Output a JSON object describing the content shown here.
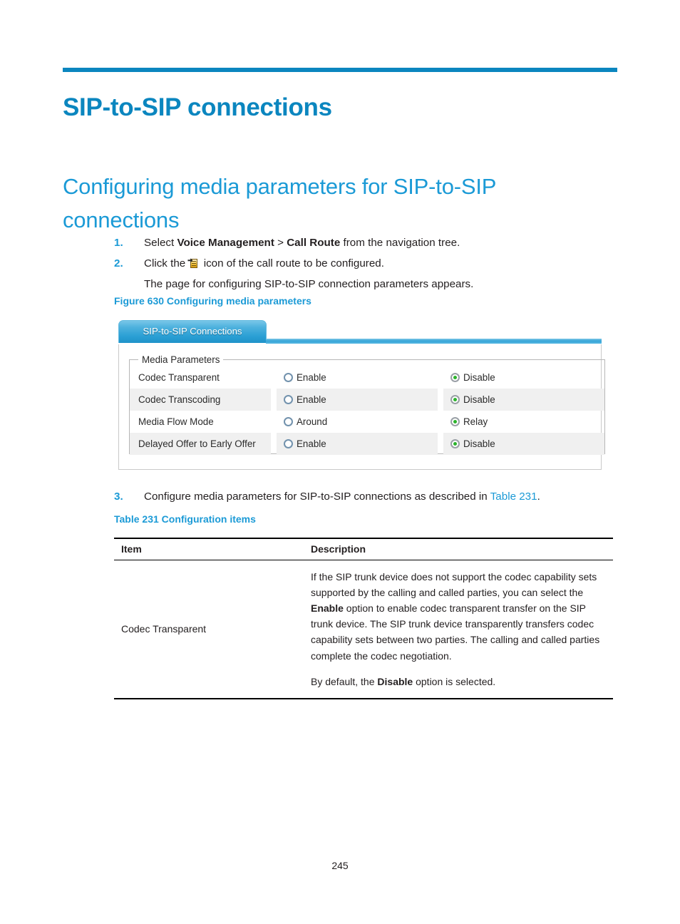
{
  "document": {
    "h1": "SIP-to-SIP connections",
    "h2": "Configuring media parameters for SIP-to-SIP connections",
    "page_number": "245",
    "accent_color": "#0b86bf",
    "heading_color": "#1b9ad6"
  },
  "steps": [
    {
      "num": "1.",
      "parts": [
        {
          "text": "Select ",
          "bold": false
        },
        {
          "text": "Voice Management",
          "bold": true
        },
        {
          "text": " > ",
          "bold": false
        },
        {
          "text": "Call Route",
          "bold": true
        },
        {
          "text": " from the navigation tree.",
          "bold": false
        }
      ]
    },
    {
      "num": "2.",
      "parts": [
        {
          "text": "Click the ",
          "bold": false
        },
        {
          "text": "ICON",
          "bold": false,
          "icon": "configure-route-icon"
        },
        {
          "text": " icon of the call route to be configured.",
          "bold": false
        }
      ],
      "sub": "The page for configuring SIP-to-SIP connection parameters appears."
    },
    {
      "num": "3.",
      "parts": [
        {
          "text": "Configure media parameters for SIP-to-SIP connections as described in ",
          "bold": false
        },
        {
          "text": "Table 231",
          "bold": false,
          "link": true
        },
        {
          "text": ".",
          "bold": false
        }
      ]
    }
  ],
  "figure": {
    "caption": "Figure 630 Configuring media parameters",
    "tab_label": "SIP-to-SIP Connections",
    "fieldset_legend": "Media Parameters",
    "rows": [
      {
        "label": "Codec Transparent",
        "option_a": {
          "text": "Enable",
          "selected": false
        },
        "option_b": {
          "text": "Disable",
          "selected": true
        }
      },
      {
        "label": "Codec Transcoding",
        "option_a": {
          "text": "Enable",
          "selected": false
        },
        "option_b": {
          "text": "Disable",
          "selected": true
        }
      },
      {
        "label": "Media Flow Mode",
        "option_a": {
          "text": "Around",
          "selected": false
        },
        "option_b": {
          "text": "Relay",
          "selected": true
        }
      },
      {
        "label": "Delayed Offer to Early Offer",
        "option_a": {
          "text": "Enable",
          "selected": false
        },
        "option_b": {
          "text": "Disable",
          "selected": true
        }
      }
    ]
  },
  "table": {
    "caption": "Table 231 Configuration items",
    "headers": {
      "item": "Item",
      "description": "Description"
    },
    "rows": [
      {
        "item": "Codec Transparent",
        "paragraphs": [
          [
            {
              "text": "If the SIP trunk device does not support the codec capability sets supported by the calling and called parties, you can select the ",
              "bold": false
            },
            {
              "text": "Enable",
              "bold": true
            },
            {
              "text": " option to enable codec transparent transfer on the SIP trunk device. The SIP trunk device transparently transfers codec capability sets between two parties. The calling and called parties complete the codec negotiation.",
              "bold": false
            }
          ],
          [
            {
              "text": "By default, the ",
              "bold": false
            },
            {
              "text": "Disable",
              "bold": true
            },
            {
              "text": " option is selected.",
              "bold": false
            }
          ]
        ]
      }
    ]
  }
}
